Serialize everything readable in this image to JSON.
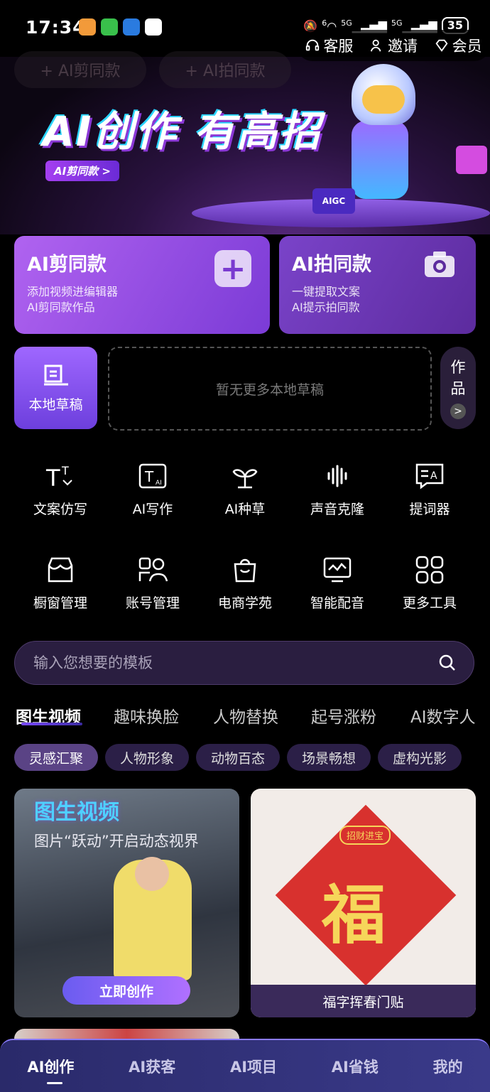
{
  "status_bar": {
    "time": "17:34",
    "signal1": "5G",
    "signal2": "5G",
    "battery": "35",
    "wifi_badge": "6"
  },
  "top_links": {
    "service": "客服",
    "invite": "邀请",
    "member": "会员"
  },
  "ghost_buttons": [
    "+ AI剪同款",
    "+ AI拍同款"
  ],
  "banner": {
    "title": "AI创作 有高招",
    "tag": "AI剪同款 >",
    "badge": "AIGC"
  },
  "cards": {
    "cut": {
      "title": "AI剪同款",
      "line1": "添加视频进编辑器",
      "line2": "AI剪同款作品"
    },
    "shoot": {
      "title": "AI拍同款",
      "line1": "一键提取文案",
      "line2": "AI提示拍同款"
    }
  },
  "drafts": {
    "local_label": "本地草稿",
    "empty_text": "暂无更多本地草稿",
    "works_1": "作",
    "works_2": "品",
    "works_arrow": ">"
  },
  "tools": [
    {
      "label": "文案仿写",
      "icon": "text-rewrite-icon"
    },
    {
      "label": "AI写作",
      "icon": "ai-writing-icon"
    },
    {
      "label": "AI种草",
      "icon": "sprout-icon"
    },
    {
      "label": "声音克隆",
      "icon": "voice-clone-icon"
    },
    {
      "label": "提词器",
      "icon": "teleprompter-icon"
    },
    {
      "label": "橱窗管理",
      "icon": "storefront-icon"
    },
    {
      "label": "账号管理",
      "icon": "account-icon"
    },
    {
      "label": "电商学苑",
      "icon": "shopping-bag-icon"
    },
    {
      "label": "智能配音",
      "icon": "dubbing-icon"
    },
    {
      "label": "更多工具",
      "icon": "grid-icon"
    }
  ],
  "search": {
    "placeholder": "输入您想要的模板"
  },
  "tabs": [
    "图生视频",
    "趣味换脸",
    "人物替换",
    "起号涨粉",
    "AI数字人"
  ],
  "chips": [
    "灵感汇聚",
    "人物形象",
    "动物百态",
    "场景畅想",
    "虚构光影"
  ],
  "content": {
    "card1": {
      "title": "图生视频",
      "subtitle": "图片“跃动”开启动态视界",
      "button": "立即创作"
    },
    "card2": {
      "tag": "招财进宝",
      "char": "福",
      "caption": "福字挥春门贴"
    }
  },
  "bottom_nav": [
    "AI创作",
    "AI获客",
    "AI项目",
    "AI省钱",
    "我的"
  ],
  "colors": {
    "accent_purple": "#9b5cf0",
    "card_purple": "#7b3bd6",
    "nav_bg": "#2a2a6a"
  }
}
